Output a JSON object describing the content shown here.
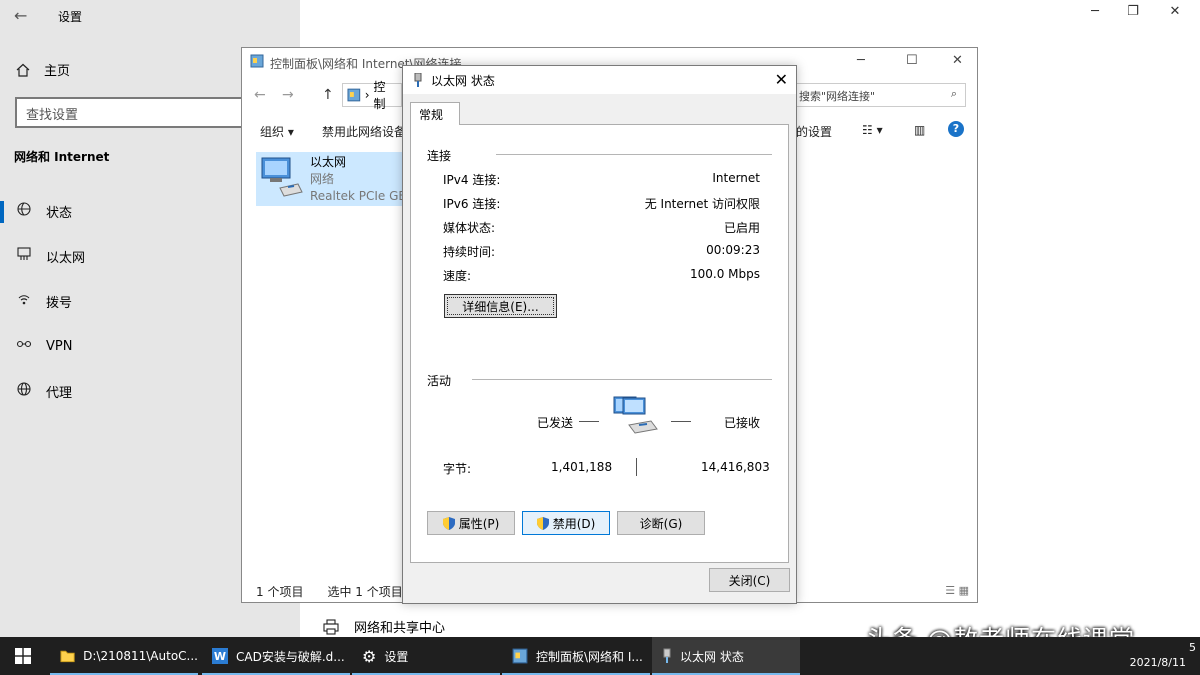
{
  "settings": {
    "window_title": "设置",
    "home_label": "主页",
    "search_placeholder": "查找设置",
    "section_title": "网络和 Internet",
    "nav_items": [
      {
        "label": "状态",
        "icon": "globe-network-icon"
      },
      {
        "label": "以太网",
        "icon": "ethernet-icon"
      },
      {
        "label": "拨号",
        "icon": "dialup-icon"
      },
      {
        "label": "VPN",
        "icon": "vpn-icon"
      },
      {
        "label": "代理",
        "icon": "proxy-globe-icon"
      }
    ],
    "network_sharing_center": "网络和共享中心"
  },
  "netconn": {
    "title": "控制面板\\网络和 Internet\\网络连接",
    "address_crumb": "控制",
    "search_placeholder": "搜索\"网络连接\"",
    "toolbar": {
      "organize": "组织 ▾",
      "disable_device": "禁用此网络设备",
      "settings_partial": "的设置"
    },
    "connection": {
      "name": "以太网",
      "type": "网络",
      "adapter": "Realtek PCIe GBE"
    },
    "status": {
      "count": "1 个项目",
      "selected": "选中 1 个项目"
    }
  },
  "dialog": {
    "title": "以太网 状态",
    "tab": "常规",
    "connection_group": "连接",
    "rows": [
      {
        "label": "IPv4 连接:",
        "value": "Internet"
      },
      {
        "label": "IPv6 连接:",
        "value": "无 Internet 访问权限"
      },
      {
        "label": "媒体状态:",
        "value": "已启用"
      },
      {
        "label": "持续时间:",
        "value": "00:09:23"
      },
      {
        "label": "速度:",
        "value": "100.0 Mbps"
      }
    ],
    "details_button": "详细信息(E)...",
    "activity_group": "活动",
    "sent_label": "已发送",
    "received_label": "已接收",
    "bytes_label": "字节:",
    "bytes_sent": "1,401,188",
    "bytes_received": "14,416,803",
    "properties_button": "属性(P)",
    "disable_button": "禁用(D)",
    "diagnose_button": "诊断(G)",
    "close_button": "关闭(C)"
  },
  "taskbar": {
    "items": [
      {
        "label": "D:\\210811\\AutoC..."
      },
      {
        "label": "CAD安装与破解.d..."
      },
      {
        "label": "设置"
      },
      {
        "label": "控制面板\\网络和 I..."
      },
      {
        "label": "以太网 状态"
      }
    ],
    "clock_date": "2021/8/11",
    "clock_time": "5"
  },
  "watermark": "头条 @敖老师在线课堂",
  "colors": {
    "accent": "#0067c0",
    "selection": "#cce8ff",
    "taskbar": "#1f1f1f"
  }
}
